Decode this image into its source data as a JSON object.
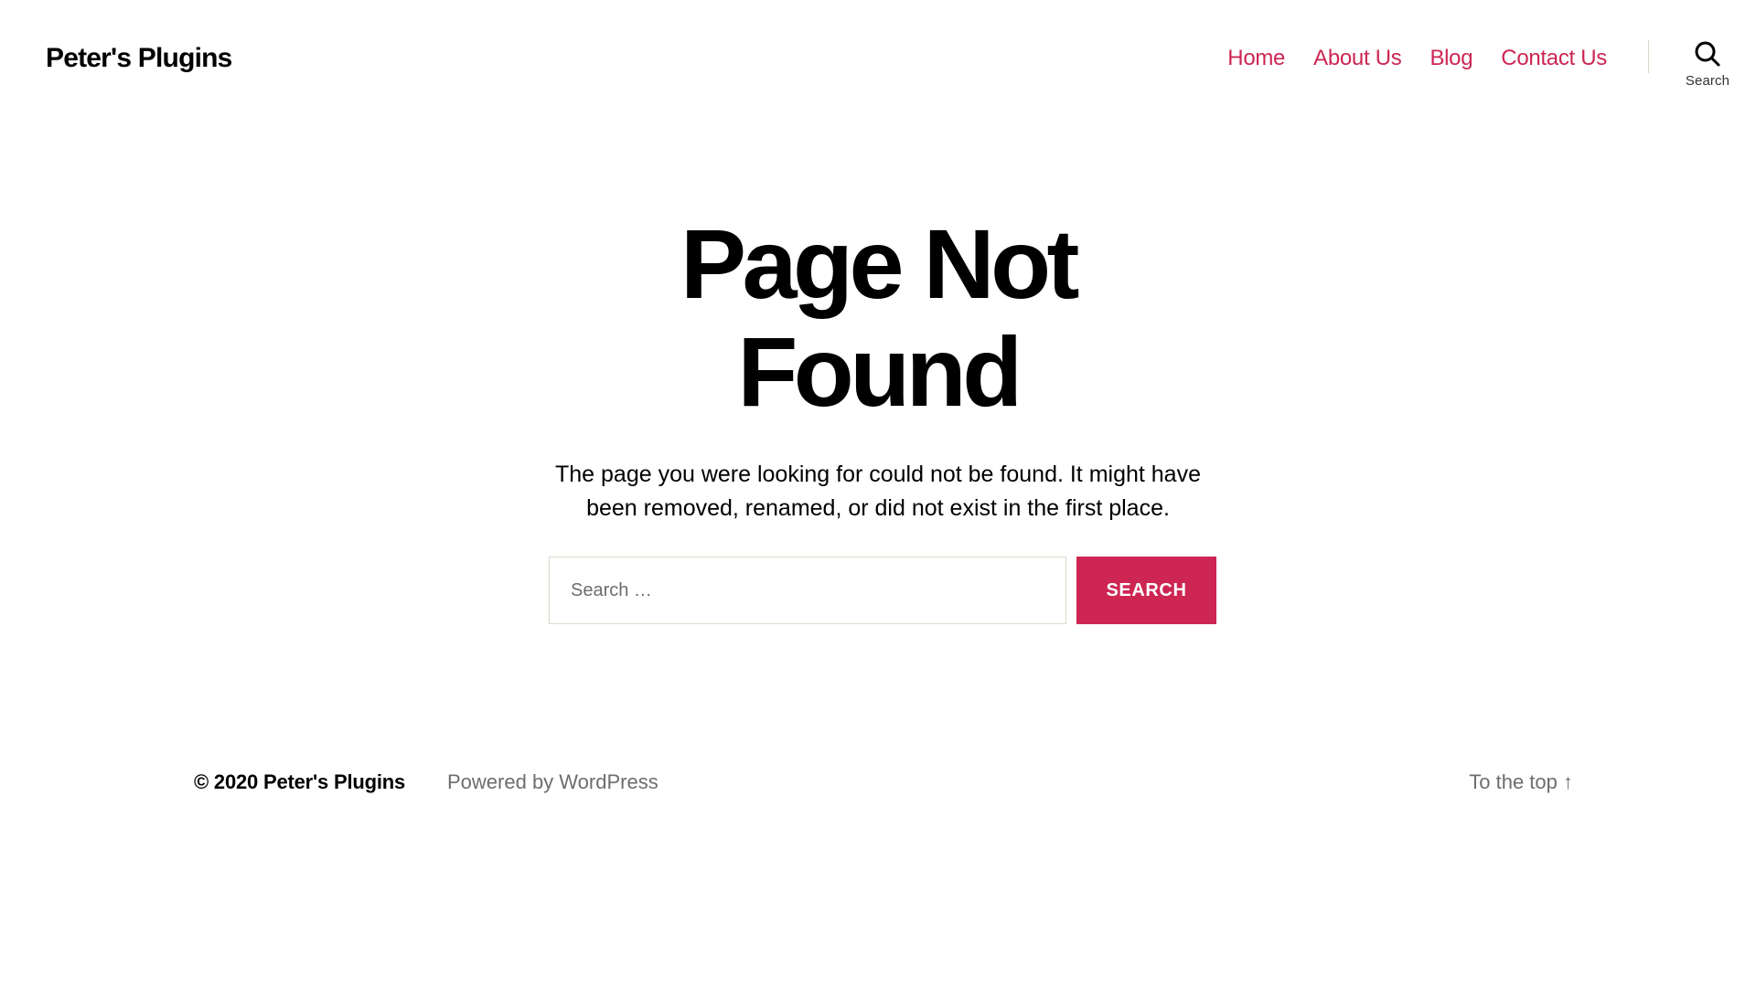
{
  "header": {
    "site_title": "Peter's Plugins",
    "nav": [
      {
        "label": "Home"
      },
      {
        "label": "About Us"
      },
      {
        "label": "Blog"
      },
      {
        "label": "Contact Us"
      }
    ],
    "search_toggle_label": "Search",
    "search_toggle_icon": "search-icon"
  },
  "main": {
    "title": "Page Not Found",
    "intro": "The page you were looking for could not be found. It might have been removed, renamed, or did not exist in the first place.",
    "search": {
      "placeholder": "Search …",
      "value": "",
      "submit_label": "SEARCH"
    }
  },
  "footer": {
    "copyright": "© 2020 Peter's Plugins",
    "powered_by": "Powered by WordPress",
    "to_top": "To the top ↑"
  },
  "colors": {
    "accent": "#cd2653",
    "text": "#000000",
    "muted": "#6d6d6d",
    "border": "#dcd7ca",
    "background": "#ffffff"
  }
}
